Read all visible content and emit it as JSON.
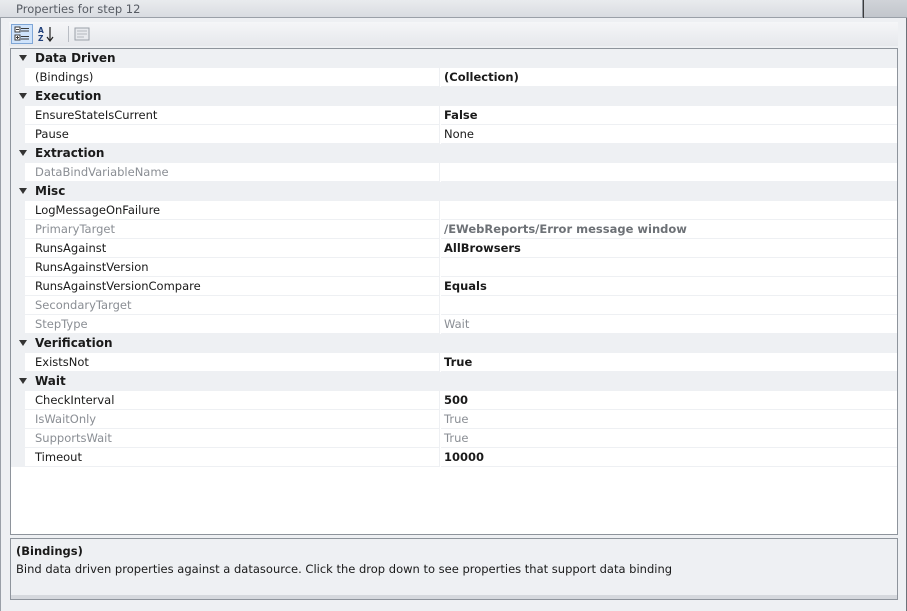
{
  "window": {
    "title": "Properties for step 12"
  },
  "toolbar": {
    "categorized_icon": "categorized-view-icon",
    "alphabetical_icon": "alphabetical-sort-icon",
    "property_pages_icon": "property-pages-icon"
  },
  "grid": {
    "categories": [
      {
        "label": "Data Driven",
        "properties": [
          {
            "name": "(Bindings)",
            "value": "(Collection)",
            "bold": true,
            "readonly": false
          }
        ]
      },
      {
        "label": "Execution",
        "properties": [
          {
            "name": "EnsureStateIsCurrent",
            "value": "False",
            "bold": true,
            "readonly": false
          },
          {
            "name": "Pause",
            "value": "None",
            "bold": false,
            "readonly": false
          }
        ]
      },
      {
        "label": "Extraction",
        "properties": [
          {
            "name": "DataBindVariableName",
            "value": "",
            "bold": false,
            "readonly": true
          }
        ]
      },
      {
        "label": "Misc",
        "properties": [
          {
            "name": "LogMessageOnFailure",
            "value": "",
            "bold": false,
            "readonly": false
          },
          {
            "name": "PrimaryTarget",
            "value": "/EWebReports/Error message window",
            "bold": true,
            "readonly": true
          },
          {
            "name": "RunsAgainst",
            "value": "AllBrowsers",
            "bold": true,
            "readonly": false
          },
          {
            "name": "RunsAgainstVersion",
            "value": "",
            "bold": false,
            "readonly": false
          },
          {
            "name": "RunsAgainstVersionCompare",
            "value": "Equals",
            "bold": true,
            "readonly": false
          },
          {
            "name": "SecondaryTarget",
            "value": "",
            "bold": false,
            "readonly": true
          },
          {
            "name": "StepType",
            "value": "Wait",
            "bold": false,
            "readonly": true
          }
        ]
      },
      {
        "label": "Verification",
        "properties": [
          {
            "name": "ExistsNot",
            "value": "True",
            "bold": true,
            "readonly": false
          }
        ]
      },
      {
        "label": "Wait",
        "properties": [
          {
            "name": "CheckInterval",
            "value": "500",
            "bold": true,
            "readonly": false
          },
          {
            "name": "IsWaitOnly",
            "value": "True",
            "bold": false,
            "readonly": true
          },
          {
            "name": "SupportsWait",
            "value": "True",
            "bold": false,
            "readonly": true
          },
          {
            "name": "Timeout",
            "value": "10000",
            "bold": true,
            "readonly": false
          }
        ]
      }
    ]
  },
  "description": {
    "title": "(Bindings)",
    "text": "Bind data driven properties against a datasource. Click the drop down to see properties that support data binding"
  },
  "colors": {
    "category_background": "#eef0f3",
    "readonly_text": "#8a8e94",
    "toolbar_active": "#cfe3fb"
  }
}
